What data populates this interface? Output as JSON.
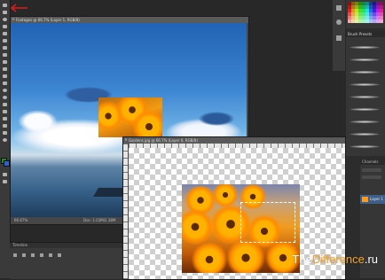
{
  "colors": {
    "arrow": "#d41f1f",
    "watermark_accent": "#f4a52a"
  },
  "tools": [
    "move-tool",
    "marquee-tool",
    "lasso-tool",
    "quick-select-tool",
    "crop-tool",
    "eyedropper-tool",
    "healing-brush-tool",
    "brush-tool",
    "clone-stamp-tool",
    "history-brush-tool",
    "eraser-tool",
    "gradient-tool",
    "blur-tool",
    "dodge-tool",
    "pen-tool",
    "type-tool",
    "path-select-tool",
    "rectangle-tool",
    "hand-tool",
    "zoom-tool"
  ],
  "doc1": {
    "title": "Footages @ 66.7% (Layer 1, RGB/8)",
    "zoom": "66.67%",
    "doc_size": "Doc: 1.03M/2.38M"
  },
  "doc2": {
    "title": "Gardens.jpg @ 66.7% (Layer 0, RGB/8)"
  },
  "timeline": {
    "title": "Timeline"
  },
  "right_panel": {
    "brush_presets_title": "Brush Presets",
    "channels_tab": "Channels",
    "layer_name": "Layer 1"
  },
  "watermark": {
    "part1": "The",
    "part2": "Difference",
    "part3": ".ru"
  }
}
